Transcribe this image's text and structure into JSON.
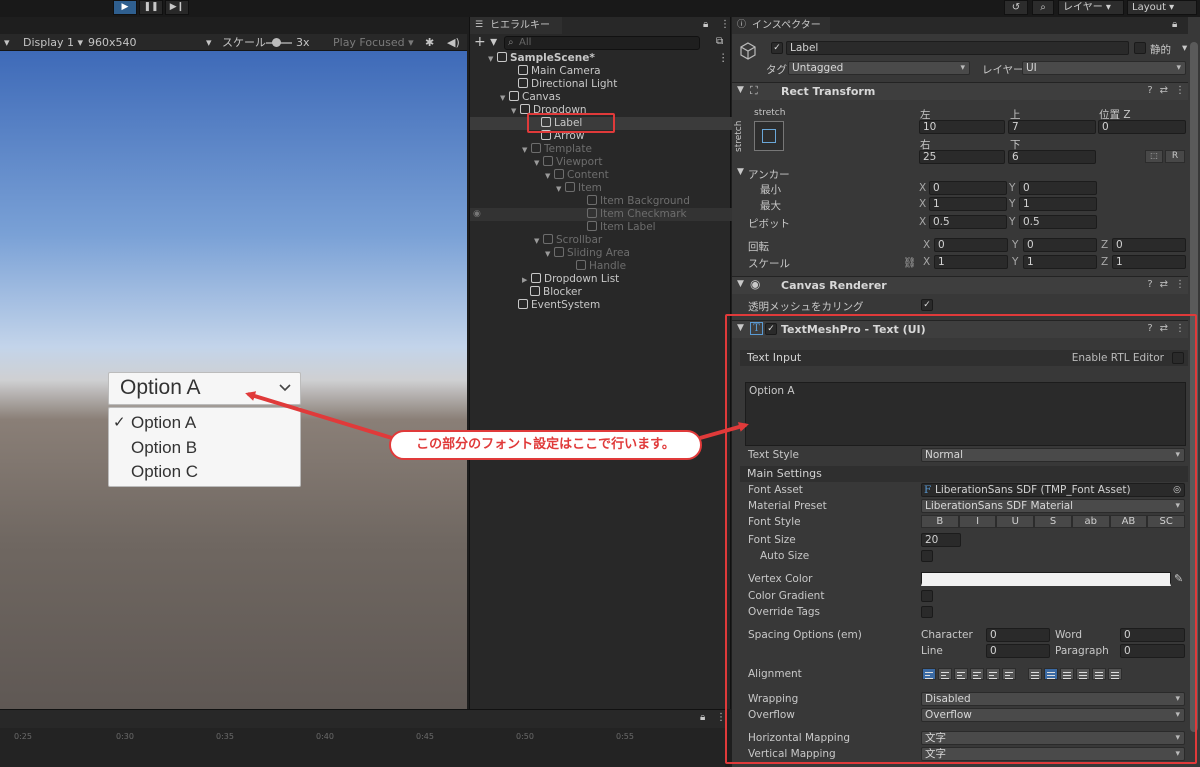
{
  "toolbar": {
    "play_icon": "play-icon",
    "pause_icon": "pause-icon",
    "step_icon": "step-icon",
    "layers_label": "レイヤー",
    "layout_label": "Layout"
  },
  "game_view": {
    "display": "Display 1",
    "resolution": "960x540",
    "scale_label": "スケール",
    "scale_value": "3x",
    "play_focused": "Play Focused"
  },
  "dropdown_preview": {
    "label": "Option A",
    "options": [
      "Option A",
      "Option B",
      "Option C"
    ],
    "checkmark": "✓"
  },
  "timeline": {
    "ticks": [
      "0:25",
      "0:30",
      "0:35",
      "0:40",
      "0:45",
      "0:50",
      "0:55"
    ]
  },
  "hierarchy": {
    "tab_label": "ヒエラルキー",
    "search_placeholder": "All",
    "add_label": "+ ▾",
    "items": [
      {
        "label": "SampleScene*"
      },
      {
        "label": "Main Camera"
      },
      {
        "label": "Directional Light"
      },
      {
        "label": "Canvas"
      },
      {
        "label": "Dropdown"
      },
      {
        "label": "Label"
      },
      {
        "label": "Arrow"
      },
      {
        "label": "Template"
      },
      {
        "label": "Viewport"
      },
      {
        "label": "Content"
      },
      {
        "label": "Item"
      },
      {
        "label": "Item Background"
      },
      {
        "label": "Item Checkmark"
      },
      {
        "label": "Item Label"
      },
      {
        "label": "Scrollbar"
      },
      {
        "label": "Sliding Area"
      },
      {
        "label": "Handle"
      },
      {
        "label": "Dropdown List"
      },
      {
        "label": "Blocker"
      },
      {
        "label": "EventSystem"
      }
    ]
  },
  "inspector": {
    "tab_label": "インスペクター",
    "object_name": "Label",
    "static_label": "静的",
    "tag_label": "タグ",
    "tag_value": "Untagged",
    "layer_label": "レイヤー",
    "layer_value": "UI",
    "rect_transform": {
      "title": "Rect Transform",
      "stretch": "stretch",
      "left_label": "左",
      "top_label": "上",
      "posz_label": "位置 Z",
      "left": "10",
      "top": "7",
      "posz": "0",
      "right_label": "右",
      "bottom_label": "下",
      "right": "25",
      "bottom": "6",
      "r_button": "R",
      "anchor_label": "アンカー",
      "min_label": "最小",
      "max_label": "最大",
      "min_x": "0",
      "min_y": "0",
      "max_x": "1",
      "max_y": "1",
      "pivot_label": "ピボット",
      "pivot_x": "0.5",
      "pivot_y": "0.5",
      "rotation_label": "回転",
      "rot_x": "0",
      "rot_y": "0",
      "rot_z": "0",
      "scale_label": "スケール",
      "scale_x": "1",
      "scale_y": "1",
      "scale_z": "1",
      "x": "X",
      "y": "Y",
      "z": "Z"
    },
    "canvas_renderer": {
      "title": "Canvas Renderer",
      "cull_label": "透明メッシュをカリング"
    },
    "tmp": {
      "title": "TextMeshPro - Text (UI)",
      "text_input_label": "Text Input",
      "rtl_label": "Enable RTL Editor",
      "text_value": "Option A",
      "text_style_label": "Text Style",
      "text_style_value": "Normal",
      "main_settings_label": "Main Settings",
      "font_asset_label": "Font Asset",
      "font_asset_value": "LiberationSans SDF (TMP_Font Asset)",
      "material_preset_label": "Material Preset",
      "material_preset_value": "LiberationSans SDF Material",
      "font_style_label": "Font Style",
      "font_style_buttons": [
        "B",
        "I",
        "U",
        "S",
        "ab",
        "AB",
        "SC"
      ],
      "font_size_label": "Font Size",
      "font_size_value": "20",
      "auto_size_label": "Auto Size",
      "vertex_color_label": "Vertex Color",
      "color_gradient_label": "Color Gradient",
      "override_tags_label": "Override Tags",
      "spacing_label": "Spacing Options (em)",
      "character_label": "Character",
      "character_value": "0",
      "word_label": "Word",
      "word_value": "0",
      "line_label": "Line",
      "line_value": "0",
      "paragraph_label": "Paragraph",
      "paragraph_value": "0",
      "alignment_label": "Alignment",
      "wrapping_label": "Wrapping",
      "wrapping_value": "Disabled",
      "overflow_label": "Overflow",
      "overflow_value": "Overflow",
      "hmap_label": "Horizontal Mapping",
      "hmap_value": "文字",
      "vmap_label": "Vertical Mapping",
      "vmap_value": "文字"
    }
  },
  "annotation": {
    "text": "この部分のフォント設定はここで行います。",
    "color": "#e03a3a"
  }
}
